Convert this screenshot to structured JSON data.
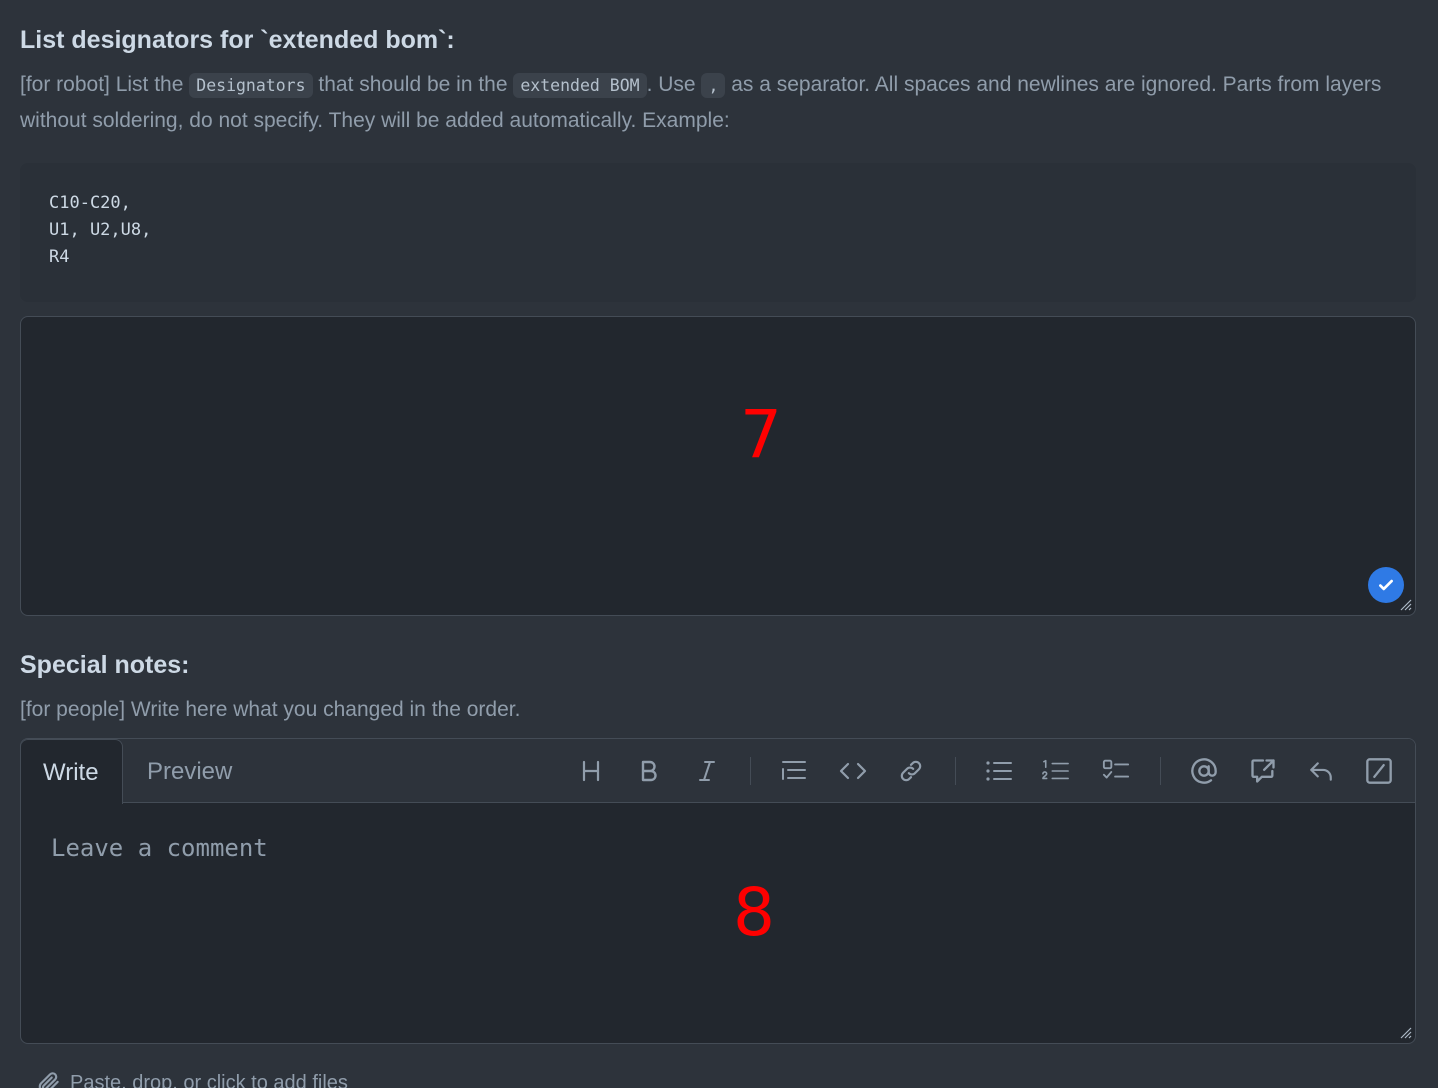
{
  "designators": {
    "title": "List designators for `extended bom`:",
    "desc_1": "[for robot] List the ",
    "code_designators": "Designators",
    "desc_2": " that should be in the ",
    "code_extended_bom": "extended BOM",
    "desc_3": ". Use ",
    "code_comma": ",",
    "desc_4": " as a separator. All spaces and newlines are ignored. Parts from layers without soldering, do not specify. They will be added automatically. Example:",
    "example": "C10-C20,\nU1, U2,U8,\nR4",
    "marker": "7"
  },
  "notes": {
    "title": "Special notes:",
    "desc": "[for people] Write here what you changed in the order.",
    "tab_write": "Write",
    "tab_preview": "Preview",
    "placeholder": "Leave a comment",
    "marker": "8",
    "files_hint": "Paste, drop, or click to add files"
  },
  "toolbar": {
    "icons": [
      "heading-icon",
      "bold-icon",
      "italic-icon",
      "quote-icon",
      "code-icon",
      "link-icon",
      "bulleted-list-icon",
      "numbered-list-icon",
      "task-list-icon",
      "mention-icon",
      "reference-icon",
      "reply-icon",
      "slash-commands-icon"
    ]
  },
  "colors": {
    "background": "#2d333b",
    "input_background": "#22272e",
    "border": "#444c56",
    "accent": "#2f7ae5",
    "marker": "#ff0000"
  }
}
